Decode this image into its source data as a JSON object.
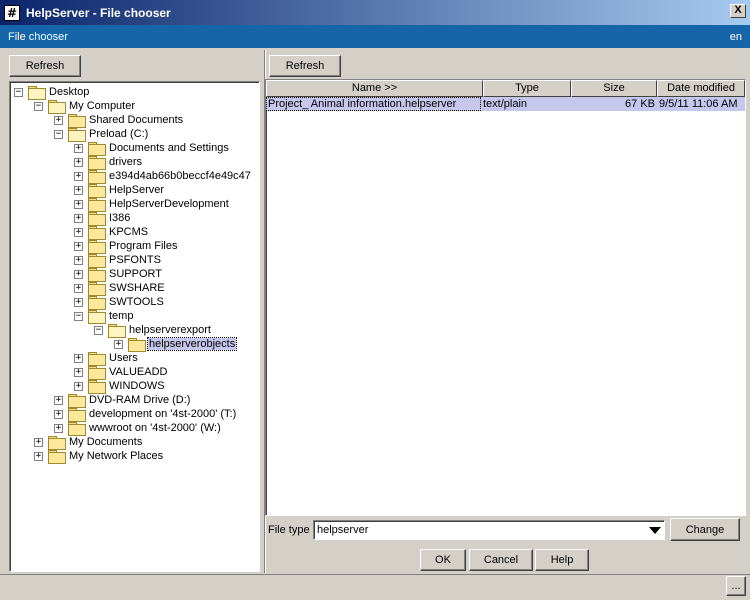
{
  "window": {
    "title": "HelpServer - File chooser",
    "close_glyph": "X",
    "app_icon_glyph": "#"
  },
  "header": {
    "title": "File chooser",
    "locale": "en"
  },
  "left_panel": {
    "refresh_label": "Refresh",
    "tree": [
      {
        "label": "Desktop",
        "expander": "−",
        "depth": 0,
        "open": true
      },
      {
        "label": "My Computer",
        "expander": "−",
        "depth": 1,
        "open": true
      },
      {
        "label": "Shared Documents",
        "expander": "+",
        "depth": 2
      },
      {
        "label": "Preload (C:)",
        "expander": "−",
        "depth": 2,
        "open": true
      },
      {
        "label": "Documents and Settings",
        "expander": "+",
        "depth": 3
      },
      {
        "label": "drivers",
        "expander": "+",
        "depth": 3
      },
      {
        "label": "e394d4ab66b0beccf4e49c47",
        "expander": "+",
        "depth": 3
      },
      {
        "label": "HelpServer",
        "expander": "+",
        "depth": 3
      },
      {
        "label": "HelpServerDevelopment",
        "expander": "+",
        "depth": 3
      },
      {
        "label": "I386",
        "expander": "+",
        "depth": 3
      },
      {
        "label": "KPCMS",
        "expander": "+",
        "depth": 3
      },
      {
        "label": "Program Files",
        "expander": "+",
        "depth": 3
      },
      {
        "label": "PSFONTS",
        "expander": "+",
        "depth": 3
      },
      {
        "label": "SUPPORT",
        "expander": "+",
        "depth": 3
      },
      {
        "label": "SWSHARE",
        "expander": "+",
        "depth": 3
      },
      {
        "label": "SWTOOLS",
        "expander": "+",
        "depth": 3
      },
      {
        "label": "temp",
        "expander": "−",
        "depth": 3,
        "open": true
      },
      {
        "label": "helpserverexport",
        "expander": "−",
        "depth": 4,
        "open": true
      },
      {
        "label": "helpserverobjects",
        "expander": "+",
        "depth": 5,
        "selected": true
      },
      {
        "label": "Users",
        "expander": "+",
        "depth": 3
      },
      {
        "label": "VALUEADD",
        "expander": "+",
        "depth": 3
      },
      {
        "label": "WINDOWS",
        "expander": "+",
        "depth": 3
      },
      {
        "label": "DVD-RAM Drive (D:)",
        "expander": "+",
        "depth": 2
      },
      {
        "label": "development on '4st-2000' (T:)",
        "expander": "+",
        "depth": 2
      },
      {
        "label": "wwwroot on '4st-2000' (W:)",
        "expander": "+",
        "depth": 2
      },
      {
        "label": "My Documents",
        "expander": "+",
        "depth": 1
      },
      {
        "label": "My Network Places",
        "expander": "+",
        "depth": 1
      }
    ]
  },
  "right_panel": {
    "refresh_label": "Refresh",
    "columns": [
      "Name >>",
      "Type",
      "Size",
      "Date modified"
    ],
    "rows": [
      {
        "name": "Project_ Animal information.helpserver",
        "type": "text/plain",
        "size": "67 KB",
        "date": "9/5/11 11:06 AM"
      }
    ],
    "file_type_label": "File type",
    "file_type_value": "helpserver",
    "change_label": "Change"
  },
  "footer": {
    "ok_label": "OK",
    "cancel_label": "Cancel",
    "help_label": "Help",
    "more_label": "..."
  }
}
